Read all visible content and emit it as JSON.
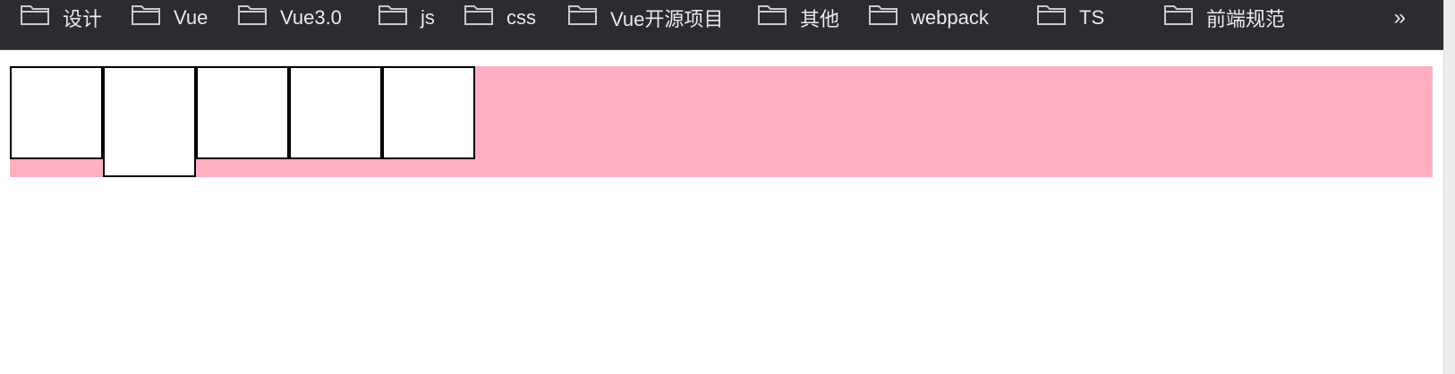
{
  "bookmarks_bar": {
    "items": [
      {
        "label": "设计",
        "icon": "folder-icon"
      },
      {
        "label": "Vue",
        "icon": "folder-icon"
      },
      {
        "label": "Vue3.0",
        "icon": "folder-icon"
      },
      {
        "label": "js",
        "icon": "folder-icon"
      },
      {
        "label": "css",
        "icon": "folder-icon"
      },
      {
        "label": "Vue开源项目",
        "icon": "folder-icon"
      },
      {
        "label": "其他",
        "icon": "folder-icon"
      },
      {
        "label": "webpack",
        "icon": "folder-icon"
      },
      {
        "label": "TS",
        "icon": "folder-icon"
      },
      {
        "label": "前端规范",
        "icon": "folder-icon"
      }
    ],
    "overflow_label": "»"
  },
  "demo": {
    "container_color": "#feafc2",
    "box_color": "#ffffff",
    "box_border_color": "#000000",
    "box_count": 5
  }
}
